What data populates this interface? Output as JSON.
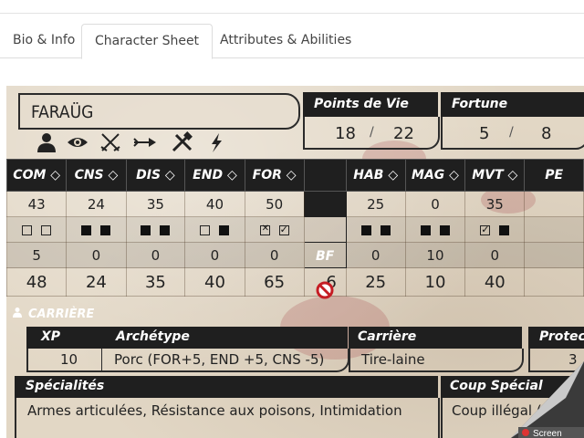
{
  "tabs": [
    {
      "label": "Bio & Info",
      "active": false
    },
    {
      "label": "Character Sheet",
      "active": true
    },
    {
      "label": "Attributes & Abilities",
      "active": false
    }
  ],
  "character": {
    "name": "FARAÜG",
    "icons": [
      "person-icon",
      "eye-icon",
      "crossed-swords-icon",
      "arrow-icon",
      "tools-icon",
      "lightning-icon"
    ]
  },
  "points_de_vie": {
    "label": "Points de Vie",
    "current": "18",
    "max": "22"
  },
  "fortune": {
    "label": "Fortune",
    "current": "5",
    "max": "8"
  },
  "separator": "/",
  "stats": {
    "headers": [
      "COM",
      "CNS",
      "DIS",
      "END",
      "FOR",
      "HAB",
      "MAG",
      "MVT",
      "PE"
    ],
    "base": [
      "43",
      "24",
      "35",
      "40",
      "50",
      "25",
      "0",
      "35",
      ""
    ],
    "checks": [
      [
        "empty",
        "empty"
      ],
      [
        "full",
        "full"
      ],
      [
        "full",
        "full"
      ],
      [
        "empty",
        "full"
      ],
      [
        "cross",
        "check"
      ],
      [
        "full",
        "full"
      ],
      [
        "full",
        "full"
      ],
      [
        "check",
        "full"
      ],
      []
    ],
    "bonus": [
      "5",
      "0",
      "0",
      "0",
      "0",
      "0",
      "10",
      "0",
      ""
    ],
    "total": [
      "48",
      "24",
      "35",
      "40",
      "65",
      "25",
      "10",
      "40",
      ""
    ],
    "bf_label": "BF",
    "bf_value": "6"
  },
  "carriere_section": {
    "label": "CARRIÈRE",
    "xp_label": "XP",
    "xp_value": "10",
    "archetype_label": "Archétype",
    "archetype_value": "Porc (FOR+5, END +5, CNS -5)",
    "carriere_label": "Carrière",
    "carriere_value": "Tire-laine",
    "protection_label": "Protect",
    "protection_value": "3"
  },
  "specialites": {
    "label": "Spécialités",
    "value": "Armes articulées, Résistance aux poisons, Intimidation"
  },
  "coup_special": {
    "label": "Coup Spécial",
    "value": "Coup illégal (Déd"
  },
  "overlay_text": "Screen"
}
